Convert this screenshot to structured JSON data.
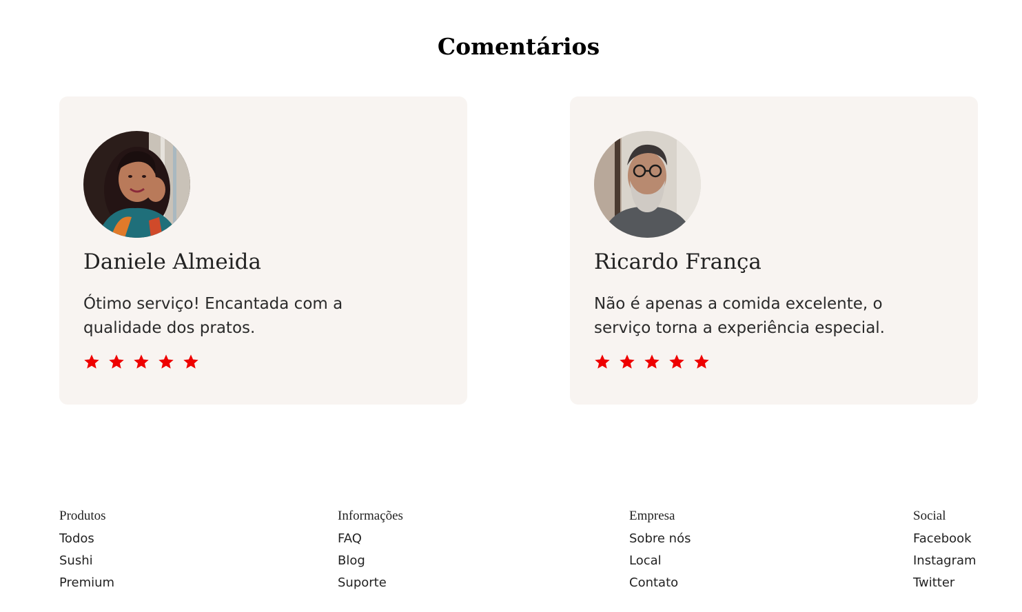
{
  "section": {
    "title": "Comentários"
  },
  "colors": {
    "card_bg": "#f8f4f1",
    "star": "#ee0000",
    "text": "#222222"
  },
  "reviews": [
    {
      "name": "Daniele Almeida",
      "comment": "Ótimo serviço! Encantada com a qualidade dos pratos.",
      "rating": 5,
      "avatar_icon": "woman-portrait"
    },
    {
      "name": "Ricardo França",
      "comment": "Não é apenas a comida excelente, o serviço torna a experiência especial.",
      "rating": 5,
      "avatar_icon": "bearded-man-portrait"
    }
  ],
  "footer": {
    "columns": [
      {
        "title": "Produtos",
        "links": [
          "Todos",
          "Sushi",
          "Premium"
        ]
      },
      {
        "title": "Informações",
        "links": [
          "FAQ",
          "Blog",
          "Suporte"
        ]
      },
      {
        "title": "Empresa",
        "links": [
          "Sobre nós",
          "Local",
          "Contato"
        ]
      },
      {
        "title": "Social",
        "links": [
          "Facebook",
          "Instagram",
          "Twitter"
        ]
      }
    ]
  }
}
